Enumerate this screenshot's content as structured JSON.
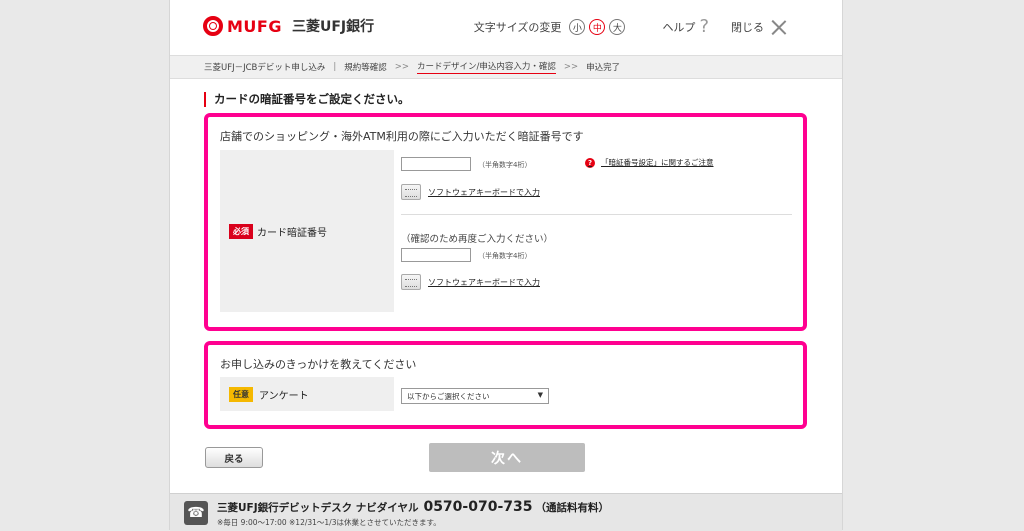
{
  "header": {
    "logo_text": "MUFG",
    "bank_name": "三菱UFJ銀行",
    "text_size_label": "文字サイズの変更",
    "sizes": [
      "小",
      "中",
      "大"
    ],
    "help_label": "ヘルプ",
    "close_label": "閉じる"
  },
  "breadcrumb": {
    "steps": [
      "三菱UFJ－JCBデビット申し込み",
      "規約等確認",
      "カードデザイン/申込内容入力・確認",
      "申込完了"
    ]
  },
  "page_title": "カードの暗証番号をご設定ください。",
  "pin_section": {
    "title": "店舗でのショッピング・海外ATM利用の際にご入力いただく暗証番号です",
    "required_badge": "必須",
    "field_label": "カード暗証番号",
    "hint": "（半角数字4桁）",
    "keyboard_link": "ソフトウェアキーボードで入力",
    "notice_link": "「暗証番号設定」に関するご注意",
    "confirm_label": "（確認のため再度ご入力ください）",
    "pin_value": "",
    "pin_confirm_value": ""
  },
  "survey_section": {
    "title": "お申し込みのきっかけを教えてください",
    "optional_badge": "任意",
    "field_label": "アンケート",
    "select_value": "以下からご選択ください"
  },
  "buttons": {
    "back": "戻る",
    "next": "次へ"
  },
  "footer": {
    "desk_name": "三菱UFJ銀行デビットデスク ナビダイヤル",
    "phone": "0570-070-735",
    "fee_note": "（通話料有料）",
    "hours": "※毎日 9:00～17:00 ※12/31～1/3は休業とさせていただきます。"
  },
  "colors": {
    "brand_red": "#e60012",
    "highlight_magenta": "#ff0090",
    "optional_yellow": "#f5b800",
    "next_button_disabled": "#bdbdbd"
  }
}
